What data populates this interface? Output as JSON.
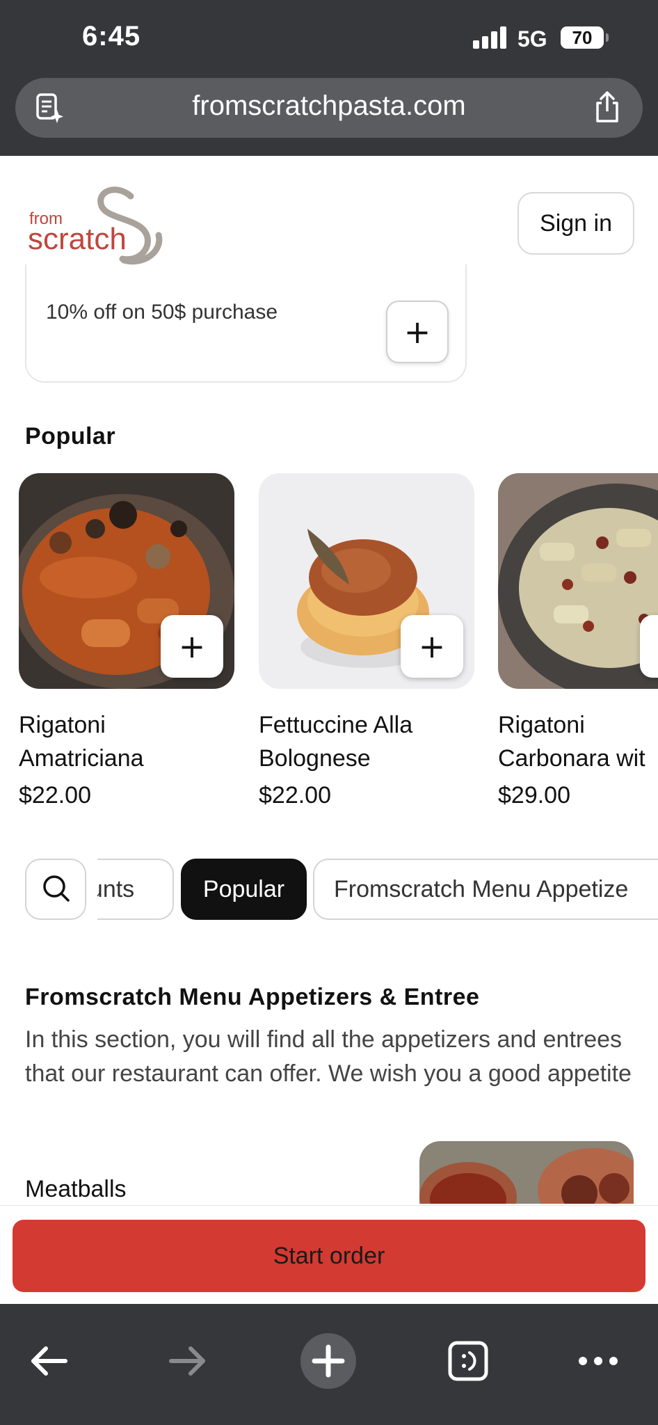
{
  "status_bar": {
    "time": "6:45",
    "network": "5G",
    "battery": "70"
  },
  "browser": {
    "url": "fromscratchpasta.com",
    "icons": {
      "reader": "reader-sparkle-icon",
      "share": "share-icon",
      "back": "back-arrow-icon",
      "forward": "forward-arrow-icon",
      "new_tab": "plus-icon",
      "tabs": "tabs-icon",
      "more": "more-icon"
    }
  },
  "header": {
    "logo_line1": "from",
    "logo_line2": "scratch",
    "sign_in": "Sign in"
  },
  "promo": {
    "text": "10% off on 50$ purchase",
    "add_label": "+"
  },
  "popular": {
    "title": "Popular",
    "items": [
      {
        "name_line1": "Rigatoni",
        "name_line2": "Amatriciana",
        "price": "$22.00",
        "add_label": "+"
      },
      {
        "name_line1": "Fettuccine Alla",
        "name_line2": "Bolognese",
        "price": "$22.00",
        "add_label": "+"
      },
      {
        "name_line1": "Rigatoni",
        "name_line2": "Carbonara wit",
        "price": "$29.00",
        "add_label": "+"
      }
    ]
  },
  "chips": {
    "discounts": "ounts",
    "popular": "Popular",
    "appetizers": "Fromscratch Menu Appetize"
  },
  "section": {
    "title": "Fromscratch Menu Appetizers & Entree",
    "description": "In this section, you will find all the appetizers and entrees that our restaurant can offer. We wish you a good appetite",
    "first_item": "Meatballs"
  },
  "order": {
    "button": "Start order"
  },
  "colors": {
    "accent": "#d33a31",
    "browser_chrome": "#36373a",
    "logo_red": "#c0463c",
    "logo_gray": "#a9a29b"
  }
}
